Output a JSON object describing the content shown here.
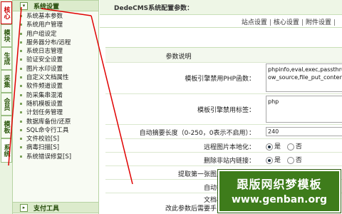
{
  "vtabs": [
    "核心",
    "模块",
    "生成",
    "采集",
    "会员",
    "模板",
    "系统"
  ],
  "menu": {
    "section_title": "系统设置",
    "items": [
      "系统基本参数",
      "系统用户管理",
      "用户组设定",
      "服务器分布/远程",
      "系统日志管理",
      "验证安全设置",
      "图片水印设置",
      "自定义文档属性",
      "软件频道设置",
      "防采集串混淆",
      "随机模板设置",
      "计划任务管理",
      "数据库备份/还原",
      "SQL命令行工具",
      "文件校验[S]",
      "病毒扫描[S]",
      "系统错误修复[S]"
    ],
    "footer_title": "支付工具"
  },
  "main": {
    "title": "DedeCMS系统配置参数：",
    "tabs": [
      "站点设置",
      "核心设置",
      "附件设置"
    ],
    "header": "参数说明",
    "rows": [
      {
        "label": "模板引擎禁用PHP函数：",
        "value": "phpinfo,eval,exec,passthru,\now_source,file_put_contents"
      },
      {
        "label": "模板引擎禁用标签：",
        "value": "php"
      },
      {
        "label": "自动摘要长度（0-250，0表示不启用）：",
        "value": "240"
      },
      {
        "label": "远程图片本地化：",
        "yes": "是",
        "no": "否"
      },
      {
        "label": "删除非站内链接：",
        "yes": "是",
        "no": "否"
      },
      {
        "label": "提取第一张图片作为缩略图",
        "yes": "是",
        "no": "否"
      },
      {
        "label": "自动提取关键字：",
        "yes": "是",
        "no": "否"
      },
      {
        "label": "文档标题最大长度",
        "sub": "改此参数后需要手工修改数据表"
      }
    ]
  },
  "watermark": {
    "line1": "跟版网织梦模板",
    "line2": "www.genban.org"
  },
  "colors": {
    "accent_green": "#3e7c1b",
    "annotation_red": "#e00000"
  }
}
